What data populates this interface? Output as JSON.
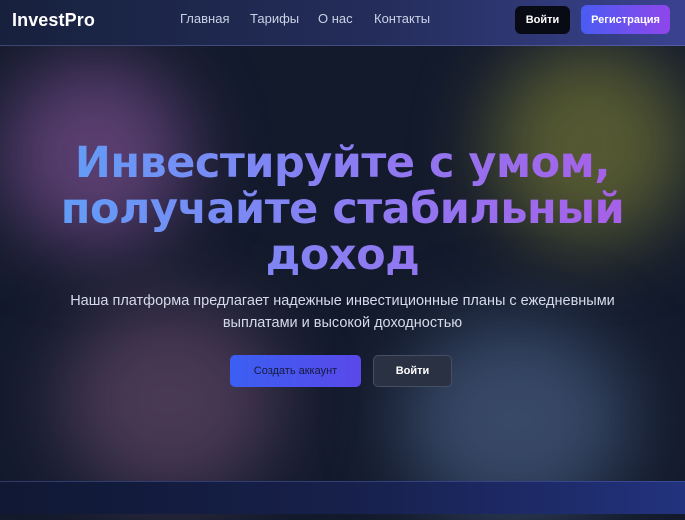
{
  "header": {
    "logo": "InvestPro",
    "nav": [
      {
        "label": "Главная"
      },
      {
        "label": "Тарифы"
      },
      {
        "label": "О нас"
      },
      {
        "label": "Контакты"
      }
    ],
    "login_label": "Войти",
    "register_label": "Регистрация"
  },
  "hero": {
    "title_line1": "Инвестируйте с умом,",
    "title_line2": "получайте стабильный",
    "title_line3": "доход",
    "subtitle_line1": "Наша платформа предлагает надежные инвестиционные планы с ежедневными",
    "subtitle_line2": "выплатами и высокой доходностью",
    "primary_button": "Создать аккаунт",
    "secondary_button": "Войти"
  },
  "colors": {
    "background": "#131a2c",
    "accent_blue": "#3b5ff2",
    "accent_purple": "#8f46ea",
    "title_gradient_start": "#5f9ff7",
    "title_gradient_end": "#a95ee8"
  }
}
